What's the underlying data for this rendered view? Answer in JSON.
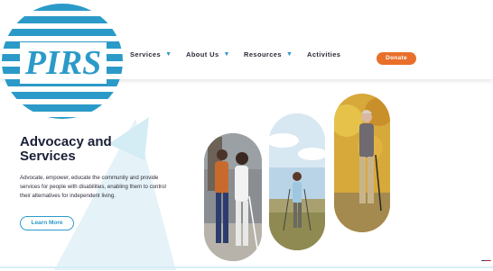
{
  "logo": {
    "text": "PIRS"
  },
  "nav": {
    "items": [
      {
        "label": "Services",
        "has_dropdown": true
      },
      {
        "label": "About Us",
        "has_dropdown": true
      },
      {
        "label": "Resources",
        "has_dropdown": true
      },
      {
        "label": "Activities",
        "has_dropdown": false
      }
    ],
    "donate_label": "Donate"
  },
  "hero": {
    "title_line1": "Advocacy and",
    "title_line2": "Services",
    "description": "Advocate, empower, educate the community and provide services for people with disabilities, enabling them to control their alternatives for independent living.",
    "cta_label": "Learn More"
  },
  "icons": {
    "dropdown": "chevron-down-icon",
    "language": "us-flag-icon"
  },
  "colors": {
    "brand_blue": "#2b9ac8",
    "donate_orange": "#e8702a",
    "heading": "#1a1f36",
    "background": "#ffffff"
  }
}
